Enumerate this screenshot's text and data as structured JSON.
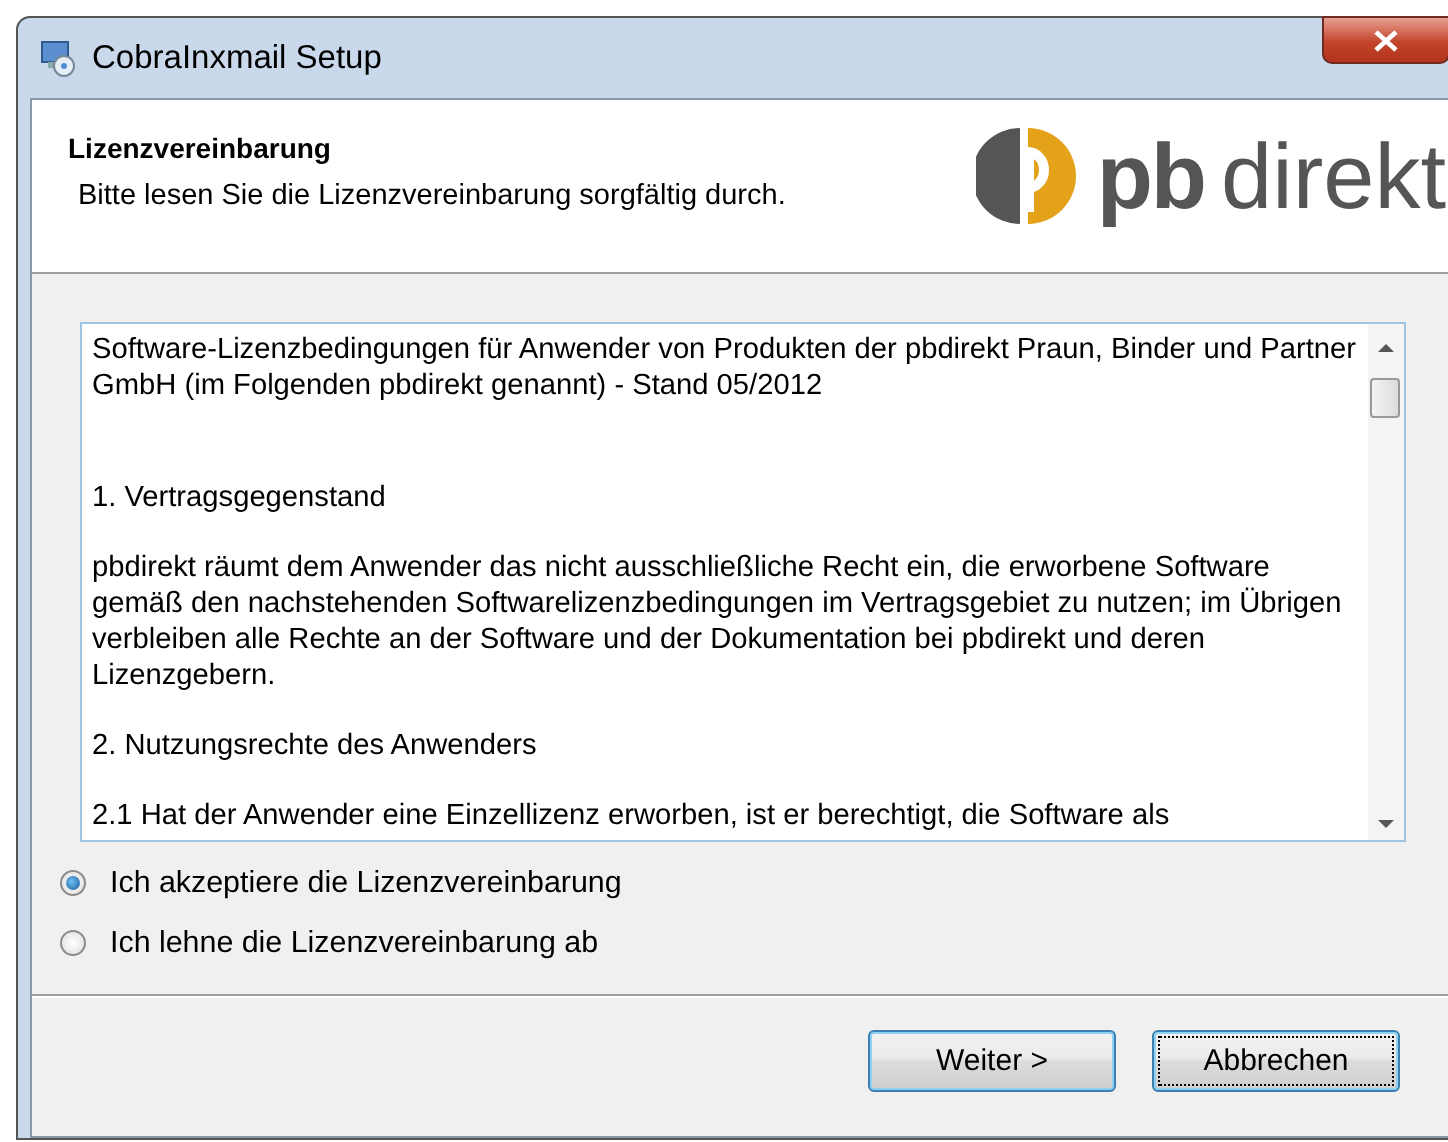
{
  "window": {
    "title": "CobraInxmail Setup"
  },
  "header": {
    "title": "Lizenzvereinbarung",
    "subtitle": "Bitte lesen Sie die Lizenzvereinbarung sorgfältig durch.",
    "logo_bold": "pb",
    "logo_light": "direkt"
  },
  "license_text": [
    "Software-Lizenzbedingungen für Anwender von Produkten der pbdirekt Praun, Binder und Partner GmbH (im Folgenden pbdirekt genannt) - Stand 05/2012",
    "1. Vertragsgegenstand",
    "pbdirekt räumt dem Anwender das nicht ausschließliche Recht ein, die erworbene Software gemäß den nachstehenden Softwarelizenzbedingungen im Vertragsgebiet zu nutzen; im Übrigen verbleiben alle Rechte an der Software und der Dokumentation bei pbdirekt und deren Lizenzgebern.",
    "2. Nutzungsrechte des Anwenders",
    "2.1 Hat der Anwender eine Einzellizenz erworben, ist er berechtigt, die Software als"
  ],
  "options": [
    {
      "label": "Ich akzeptiere die Lizenzvereinbarung",
      "selected": true
    },
    {
      "label": "Ich lehne die Lizenzvereinbarung ab",
      "selected": false
    }
  ],
  "buttons": [
    {
      "label": "Weiter >",
      "focused": false
    },
    {
      "label": "Abbrechen",
      "focused": true
    }
  ]
}
